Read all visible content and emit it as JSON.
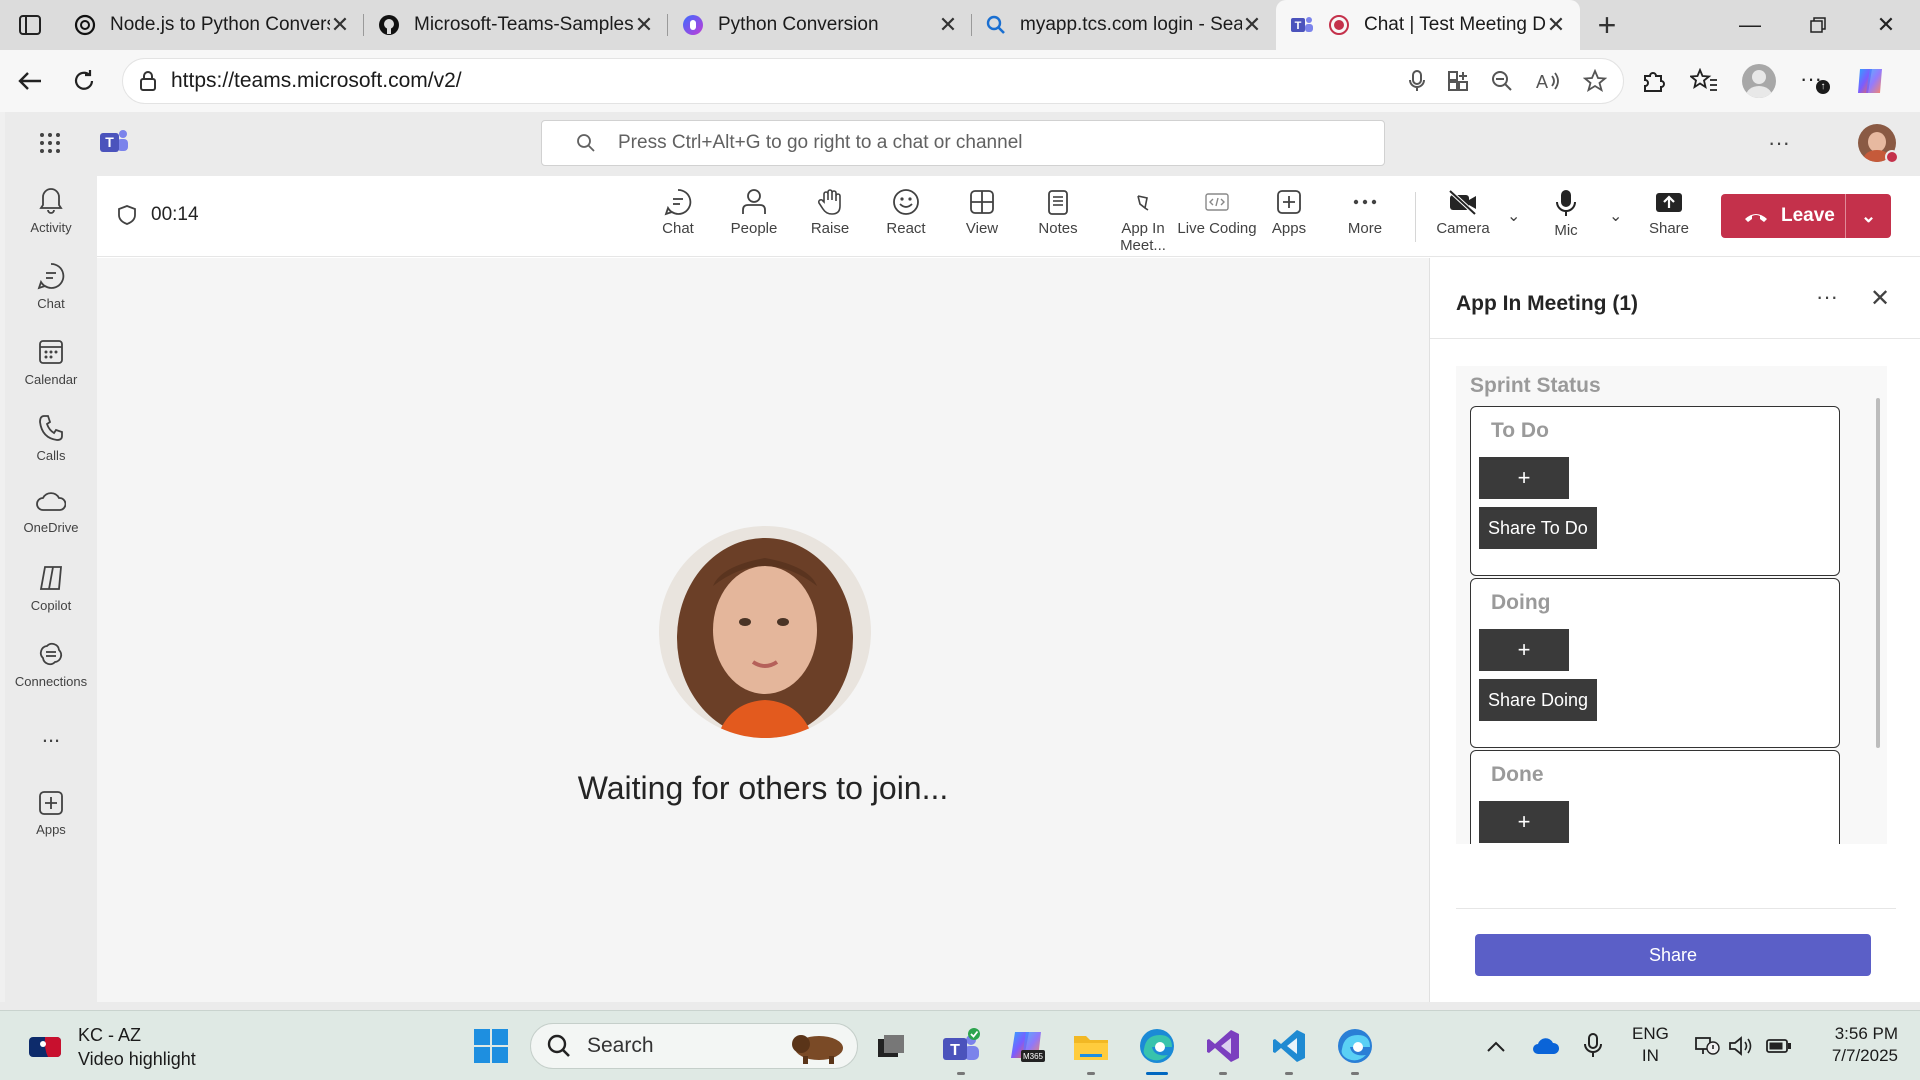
{
  "browser": {
    "tabs": [
      {
        "title": "Node.js to Python Convers",
        "icon": "chatgpt-icon"
      },
      {
        "title": "Microsoft-Teams-Samples/",
        "icon": "github-icon"
      },
      {
        "title": "Python Conversion",
        "icon": "copilot-icon"
      },
      {
        "title": "myapp.tcs.com login - Sear",
        "icon": "search-icon"
      },
      {
        "title": "Chat | Test Meeting D",
        "icon": "teams-icon",
        "active": true
      }
    ],
    "url": "https://teams.microsoft.com/v2/"
  },
  "teams": {
    "search_placeholder": "Press Ctrl+Alt+G to go right to a chat or channel",
    "rail": [
      {
        "label": "Activity",
        "icon": "bell-icon"
      },
      {
        "label": "Chat",
        "icon": "chat-icon"
      },
      {
        "label": "Calendar",
        "icon": "calendar-icon"
      },
      {
        "label": "Calls",
        "icon": "phone-icon"
      },
      {
        "label": "OneDrive",
        "icon": "cloud-icon"
      },
      {
        "label": "Copilot",
        "icon": "copilot-icon"
      },
      {
        "label": "Connections",
        "icon": "connections-icon"
      },
      {
        "label": "...",
        "icon": "more-icon"
      },
      {
        "label": "Apps",
        "icon": "apps-add-icon"
      }
    ]
  },
  "meeting": {
    "timer": "00:14",
    "toolbar": [
      {
        "label": "Chat",
        "icon": "chat-icon"
      },
      {
        "label": "People",
        "icon": "people-icon"
      },
      {
        "label": "Raise",
        "icon": "hand-icon"
      },
      {
        "label": "React",
        "icon": "smile-icon"
      },
      {
        "label": "View",
        "icon": "grid-icon"
      },
      {
        "label": "Notes",
        "icon": "notes-icon"
      },
      {
        "label": "App In Meet...",
        "icon": "app-in-meeting-icon",
        "active": true
      },
      {
        "label": "Live Coding",
        "icon": "live-coding-icon"
      },
      {
        "label": "Apps",
        "icon": "apps-add-icon"
      },
      {
        "label": "More",
        "icon": "more-icon"
      }
    ],
    "camera_label": "Camera",
    "mic_label": "Mic",
    "share_label": "Share",
    "leave_label": "Leave",
    "waiting_text": "Waiting for others to join..."
  },
  "panel": {
    "title": "App In Meeting (1)",
    "app_title": "Sprint Status",
    "columns": [
      {
        "title": "To Do",
        "add_label": "+",
        "share_label": "Share To Do"
      },
      {
        "title": "Doing",
        "add_label": "+",
        "share_label": "Share Doing"
      },
      {
        "title": "Done",
        "add_label": "+",
        "share_label": ""
      }
    ],
    "share_button": "Share"
  },
  "taskbar": {
    "widget_line1": "KC - AZ",
    "widget_line2": "Video highlight",
    "search_label": "Search",
    "lang_line1": "ENG",
    "lang_line2": "IN",
    "time": "3:56 PM",
    "date": "7/7/2025"
  },
  "colors": {
    "accent": "#5b5fc7",
    "leave": "#c4314b",
    "teams_purple": "#4b53bc"
  }
}
